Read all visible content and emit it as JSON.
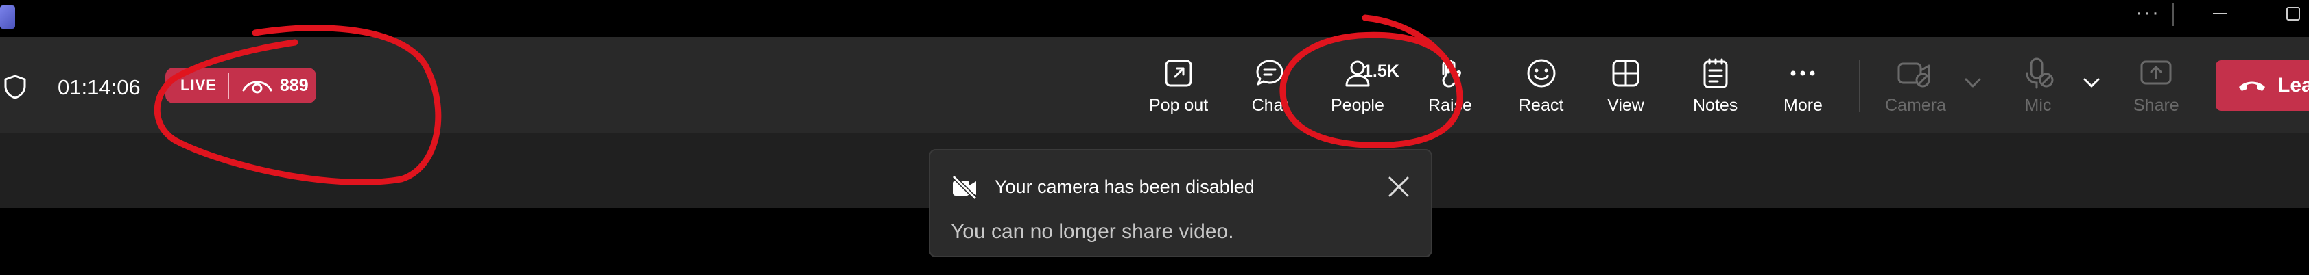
{
  "meeting": {
    "timer": "01:14:06",
    "live_label": "LIVE",
    "viewer_count": "889",
    "people_count": "1.5K"
  },
  "toolbar": {
    "popout": "Pop out",
    "chat": "Chat",
    "people": "People",
    "raise": "Raise",
    "react": "React",
    "view": "View",
    "notes": "Notes",
    "more": "More",
    "camera": "Camera",
    "mic": "Mic",
    "share": "Share",
    "leave": "Lea"
  },
  "toast": {
    "title": "Your camera has been disabled",
    "message": "You can no longer share video."
  },
  "colors": {
    "live_red": "#c4314b",
    "toolbar_bg": "#292929",
    "annotation_red": "#e0141e"
  },
  "icons": [
    "shield-icon",
    "eye-icon",
    "popout-icon",
    "chat-icon",
    "people-icon",
    "raise-hand-icon",
    "react-icon",
    "view-icon",
    "notes-icon",
    "more-icon",
    "camera-off-icon",
    "mic-off-icon",
    "share-icon",
    "phone-icon",
    "chevron-down-icon",
    "video-off-icon",
    "close-icon"
  ]
}
